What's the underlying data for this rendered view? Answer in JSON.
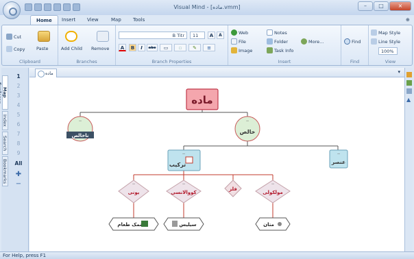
{
  "window": {
    "title": "Visual Mind - [ماده.vmm]",
    "buttons": [
      "–",
      "□",
      "×"
    ]
  },
  "ribbon": {
    "tabs": [
      "Home",
      "Insert",
      "View",
      "Map",
      "Tools"
    ],
    "clipboard": {
      "cut": "Cut",
      "copy": "Copy",
      "paste": "Paste",
      "label": "Clipboard"
    },
    "branches": {
      "add_child": "Add Child",
      "remove": "Remove",
      "label": "Branches"
    },
    "branch_properties": {
      "font": "B Titr",
      "size": "11",
      "grow": "A",
      "shrink": "A",
      "bold": "B",
      "italic": "I",
      "strike": "abc",
      "label": "Branch Properties"
    },
    "insert": {
      "web": "Web",
      "file": "File",
      "image": "Image",
      "notes": "Notes",
      "folder": "Folder",
      "task_info": "Task Info",
      "more": "More...",
      "label": "Insert"
    },
    "find": {
      "button": "Find",
      "label": "Find"
    },
    "view": {
      "map_style": "Map Style",
      "line_style": "Line Style",
      "zoom": "100%",
      "label": "View"
    }
  },
  "sidebar": {
    "tabs": [
      "Map Explorer",
      "Index",
      "Search",
      "Bookmarks"
    ],
    "levels": [
      "1",
      "2",
      "3",
      "4",
      "5",
      "6",
      "7",
      "8",
      "9"
    ],
    "all_label": "All"
  },
  "document": {
    "tab_label": "ماده"
  },
  "mindmap": {
    "root": "ماده",
    "impure": "ناخالص",
    "pure": "خالص",
    "compound": "ترکیب",
    "element": "عنصر",
    "metal": "فلز",
    "ionic": "یونی",
    "covalent": "کووالانسی",
    "molecular": "مولکولی",
    "salt": "نمک طعام",
    "silica": "سیلیس",
    "methane": "متان"
  },
  "status": {
    "text": "For Help, press F1"
  },
  "colors": {
    "accent": "#1e395b",
    "line_red": "#c0392b",
    "line_black": "#555555"
  }
}
